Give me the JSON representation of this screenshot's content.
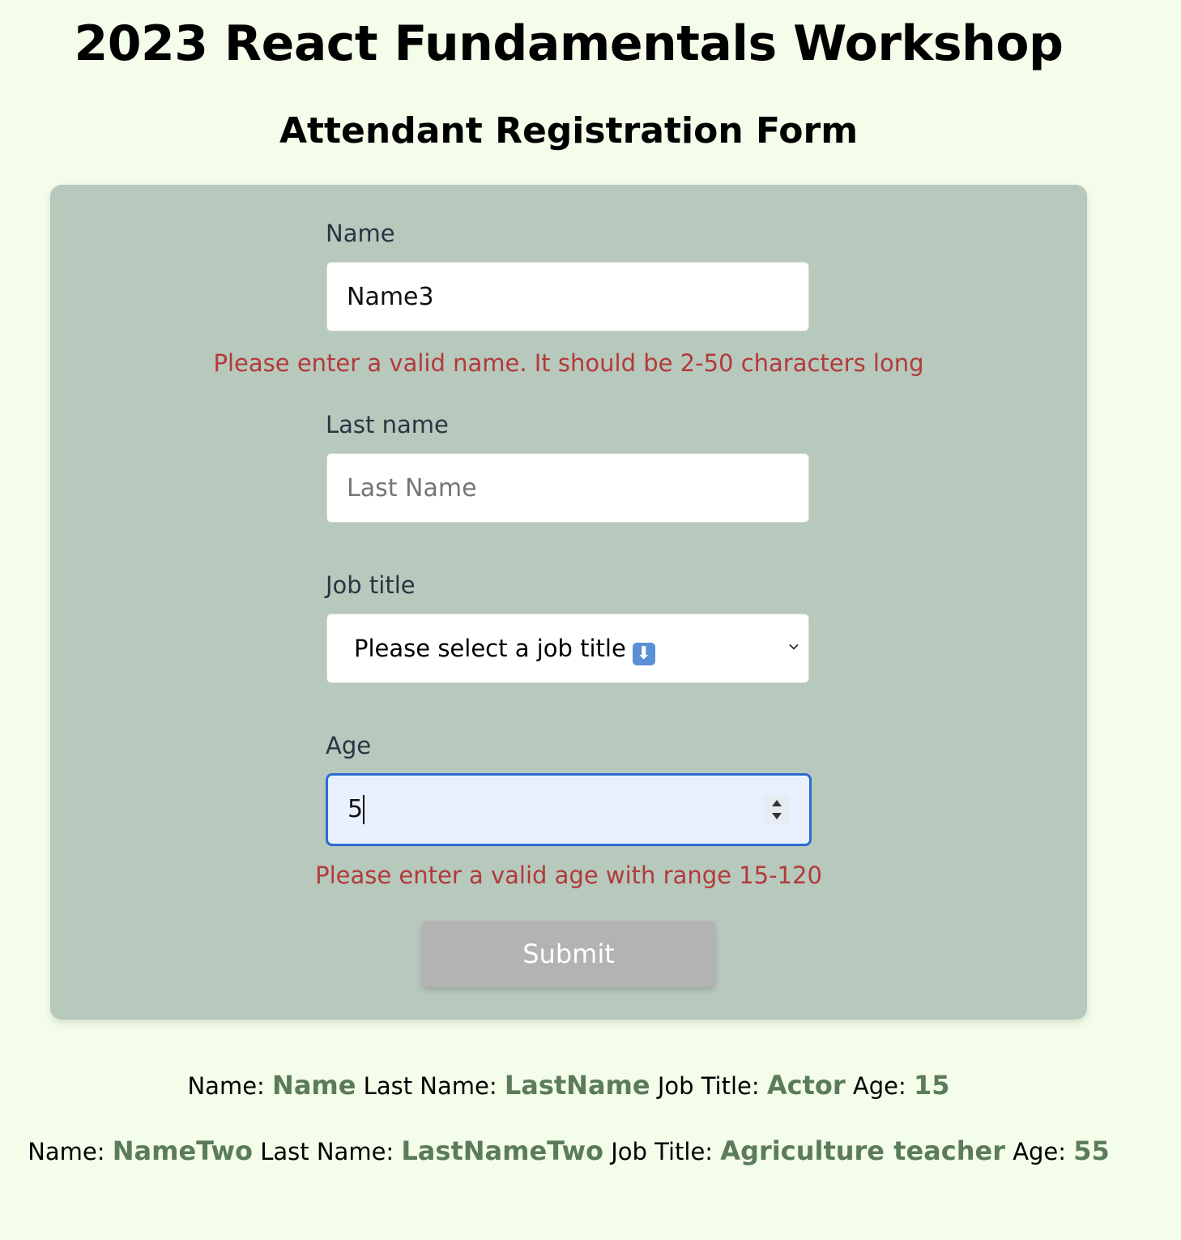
{
  "header": {
    "title": "2023 React Fundamentals Workshop",
    "subtitle": "Attendant Registration Form"
  },
  "form": {
    "name": {
      "label": "Name",
      "value": "Name3",
      "error": "Please enter a valid name. It should be 2-50 characters long"
    },
    "last_name": {
      "label": "Last name",
      "value": "",
      "placeholder": "Last Name"
    },
    "job_title": {
      "label": "Job title",
      "selected": "Please select a job title",
      "selected_emoji": "⬇"
    },
    "age": {
      "label": "Age",
      "value": "5",
      "error": "Please enter a valid age with range 15-120"
    },
    "submit_label": "Submit"
  },
  "attendees": [
    {
      "name_label": "Name:",
      "name": "Name",
      "last_name_label": "Last Name:",
      "last_name": "LastName",
      "job_label": "Job Title:",
      "job": "Actor",
      "age_label": "Age:",
      "age": "15"
    },
    {
      "name_label": "Name:",
      "name": "NameTwo",
      "last_name_label": "Last Name:",
      "last_name": "LastNameTwo",
      "job_label": "Job Title:",
      "job": "Agriculture teacher",
      "age_label": "Age:",
      "age": "55"
    }
  ],
  "colors": {
    "page_background": "#f3fde9",
    "card_background": "#b7c8bc",
    "error": "#b23a3a",
    "value_accent": "#5b7b5a",
    "focus_border": "#2d6bd1",
    "submit_disabled": "#b3b3b3"
  }
}
